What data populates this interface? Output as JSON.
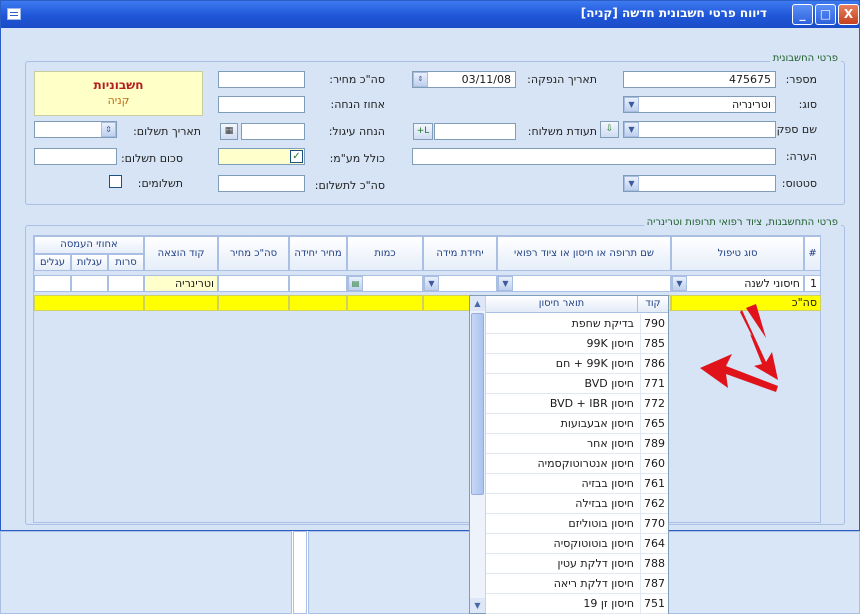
{
  "window": {
    "title": "דיווח פרטי חשבונית חדשה [קניה]",
    "buttons": {
      "minimize": "_",
      "maximize": "□",
      "close": "X"
    }
  },
  "invoice_details": {
    "legend": "פרטי החשבונית",
    "number_label": "מספר:",
    "number_value": "475675",
    "date_label": "תאריך הנפקה:",
    "date_value": "03/11/08",
    "total_price_label": "סה\"כ מחיר:",
    "type_label": "סוג:",
    "type_value": "וטרינריה",
    "discount_pct_label": "אחוז הנחה:",
    "supplier_label": "שם ספק:",
    "delivery_note_label": "תעודת משלוח:",
    "discount_label": "הנחה עיגול:",
    "note_label": "הערה:",
    "vat_label": "כולל מע\"מ:",
    "status_label": "סטטוס:",
    "total_pay_label": "סה\"כ לתשלום:",
    "pay_date_label": "תאריך תשלום:",
    "pay_amount_label": "סכום תשלום:",
    "payments_label": "תשלומים:",
    "status_box": {
      "line1": "חשבוניות",
      "line2": "קניה"
    },
    "vat_checked": true
  },
  "items": {
    "legend": "פרטי התחשבנות, ציוד רפואי תרופות וטרינריה",
    "headers": {
      "row_num": "#",
      "payment_type": "סוג טיפול",
      "drug_name": "שם תרופה או חיסון או ציוד רפואי",
      "unit": "יחידת מידה",
      "quantity": "כמות",
      "unit_price": "מחיר יחידה",
      "total_price": "סה\"כ מחיר",
      "expense_code": "קוד הוצאה",
      "packaging_group": "אחוזי העמסה",
      "pack_sub1": "סרות",
      "pack_sub2": "עגלות",
      "pack_sub3": "עגלים"
    },
    "row": {
      "num": "1",
      "payment_type": "חיסוני לשנה",
      "expense_code": "וטרינריה"
    },
    "total_label": "סה\"כ"
  },
  "vaccine_popup": {
    "header_code": "קוד",
    "header_desc": "תואר חיסון",
    "rows": [
      {
        "code": "790",
        "desc": "בדיקת שחפת"
      },
      {
        "code": "785",
        "desc": "חיסון 99K"
      },
      {
        "code": "786",
        "desc": "חיסון 99K + חם"
      },
      {
        "code": "771",
        "desc": "חיסון BVD"
      },
      {
        "code": "772",
        "desc": "חיסון BVD + IBR"
      },
      {
        "code": "765",
        "desc": "חיסון אבעבועות"
      },
      {
        "code": "789",
        "desc": "חיסון אחר"
      },
      {
        "code": "760",
        "desc": "חיסון אנטרוטוקסמיה"
      },
      {
        "code": "761",
        "desc": "חיסון בבזיה"
      },
      {
        "code": "762",
        "desc": "חיסון בבזילה"
      },
      {
        "code": "770",
        "desc": "חיסון בוטוליזם"
      },
      {
        "code": "764",
        "desc": "חיסון בוטוטוקסיה"
      },
      {
        "code": "788",
        "desc": "חיסון דלקת עטין"
      },
      {
        "code": "787",
        "desc": "חיסון דלקת ריאה"
      },
      {
        "code": "751",
        "desc": "חיסון זן 19"
      }
    ]
  },
  "colors": {
    "accent_red_arrow": "#e0121a",
    "highlight_yellow": "#ffff00",
    "panel_bg": "#d6e4f5"
  }
}
